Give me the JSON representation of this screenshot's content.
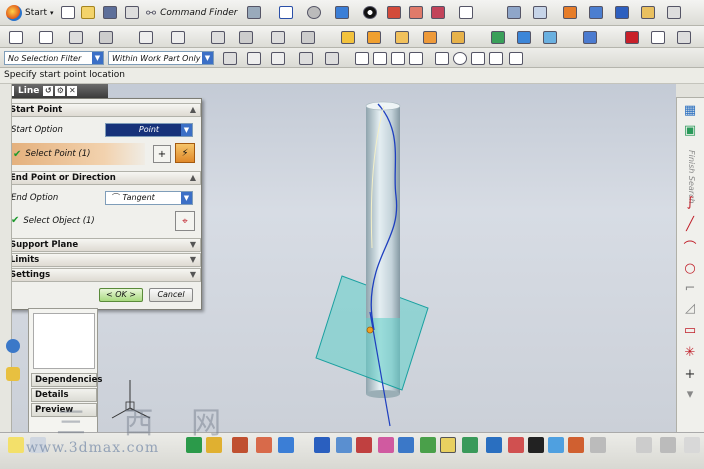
{
  "toolbar": {
    "start_label": "Start",
    "command_finder_label": "Command Finder"
  },
  "selection_bar": {
    "filter_value": "No Selection Filter",
    "scope_value": "Within Work Part Only"
  },
  "cue_line": "Specify start point location",
  "dialog": {
    "title": "Line",
    "start_point": {
      "header": "Start Point",
      "option_label": "Start Option",
      "option_value": "Point",
      "select_label": "Select Point (1)"
    },
    "end_point": {
      "header": "End Point or Direction",
      "option_label": "End Option",
      "option_value": "Tangent",
      "select_label": "Select Object (1)"
    },
    "collapsed_groups": [
      "Support Plane",
      "Limits",
      "Settings"
    ],
    "ok_label": "< OK >",
    "cancel_label": "Cancel"
  },
  "navigator": {
    "buttons": [
      "Dependencies",
      "Details",
      "Preview"
    ]
  },
  "resource_bar_right": {
    "finish_search_label": "Finish Search"
  },
  "watermark": {
    "brand_cn": "三 西 网",
    "url": "www.3dmax.com"
  },
  "colors": {
    "cylinder": "#c8d8e0",
    "plane": "#5fd0c8",
    "curve": "#1e3fbf",
    "dialog_accent": "#3b6fc6",
    "selection_highlight": "#e4b07c"
  }
}
